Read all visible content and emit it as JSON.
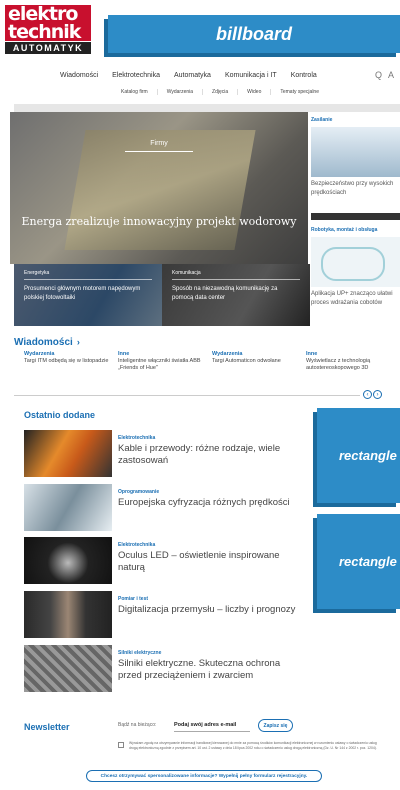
{
  "logo": {
    "line1": "elektro",
    "line2": "technik",
    "line3": "AUTOMATYK"
  },
  "ads": {
    "billboard": "billboard",
    "rect1": "rectangle",
    "rect2": "rectangle"
  },
  "nav": {
    "items": [
      "Wiadomości",
      "Elektrotechnika",
      "Automatyka",
      "Komunikacja i IT",
      "Kontrola"
    ],
    "search_icon": "Q",
    "user_icon": "A"
  },
  "subnav": {
    "items": [
      "Katalog firm",
      "Wydarzenia",
      "Zdjęcia",
      "Wideo",
      "Tematy specjalne"
    ]
  },
  "hero": {
    "category": "Firmy",
    "title": "Energa zrealizuje innowacyjny projekt wodorowy"
  },
  "sub_stories": [
    {
      "category": "Energetyka",
      "title": "Prosumenci głównym motorem napędowym polskiej fotowoltaiki"
    },
    {
      "category": "Komunikacja",
      "title": "Sposób na niezawodną komunikację za pomocą data center"
    }
  ],
  "sidebar": [
    {
      "category": "Zasilanie",
      "title": "Bezpieczeństwo przy wysokich prędkościach"
    },
    {
      "category": "Robotyka, montaż i obsługa",
      "title": "Aplikacja UP+ znacząco ułatwi proces wdrażania cobotów"
    }
  ],
  "news": {
    "heading": "Wiadomości",
    "chevron": "›",
    "items": [
      {
        "category": "Wydarzenia",
        "title": "Targi ITM odbędą się w listopadzie"
      },
      {
        "category": "Inne",
        "title": "Inteligentne włączniki światła ABB „Friends of Hue\""
      },
      {
        "category": "Wydarzenia",
        "title": "Targi Automaticon odwołane"
      },
      {
        "category": "Inne",
        "title": "Wyświetlacz z technologią autostereoskopowego 3D"
      }
    ],
    "prev": "‹",
    "next": "›"
  },
  "recent": {
    "heading": "Ostatnio dodane",
    "items": [
      {
        "category": "Elektrotechnika",
        "title": "Kable i przewody: różne rodzaje, wiele zastosowań"
      },
      {
        "category": "Oprogramowanie",
        "title": "Europejska cyfryzacja różnych prędkości"
      },
      {
        "category": "Elektrotechnika",
        "title": "Oculus LED – oświetlenie inspirowane naturą"
      },
      {
        "category": "Pomiar i test",
        "title": "Digitalizacja przemysłu – liczby i prognozy"
      },
      {
        "category": "Silniki elektryczne",
        "title": "Silniki elektryczne. Skuteczna ochrona przed przeciążeniem i zwarciem"
      }
    ]
  },
  "newsletter": {
    "heading": "Newsletter",
    "label": "Bądź na bieżąco:",
    "placeholder": "Podaj swój adres e-mail",
    "button": "Zapisz się",
    "consent": "Wyrażam zgodę na otrzymywanie informacji handlowej kierowanej do mnie za pomocą środków komunikacji elektronicznej w rozumieniu ustawy o świadczeniu usług drogą elektroniczną zgodnie z przepisem art. 10 ust. 2 ustawy z dnia 18 lipca 2002 roku o świadczeniu usług drogą elektroniczną (Dz. U. Nr 144 z 2002 r. poz. 1204).",
    "cta": "Chcesz otrzymywać spersonalizowane informacje? Wypełnij pełny formularz rejestracyjny."
  }
}
